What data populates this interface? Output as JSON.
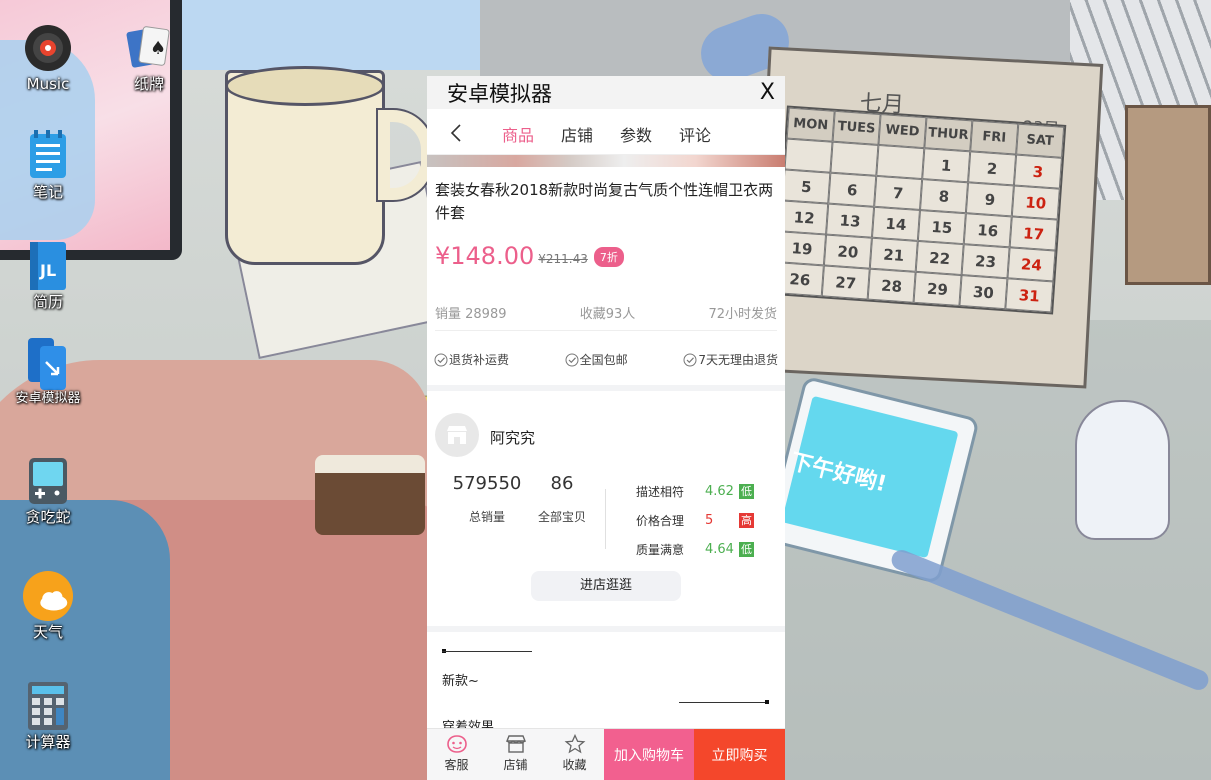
{
  "desktop": {
    "icons": [
      {
        "label": "Music",
        "icon": "music-disc-icon"
      },
      {
        "label": "纸牌",
        "icon": "solitaire-cards-icon"
      },
      {
        "label": "笔记",
        "icon": "notes-icon"
      },
      {
        "label": "简历",
        "icon": "resume-icon"
      },
      {
        "label": "安卓模拟器",
        "icon": "android-emulator-icon"
      },
      {
        "label": "贪吃蛇",
        "icon": "snake-game-icon"
      },
      {
        "label": "天气",
        "icon": "weather-icon"
      },
      {
        "label": "计算器",
        "icon": "calculator-icon"
      }
    ],
    "wallpaper": {
      "calendar_month": "七月",
      "calendar_date": "23日",
      "calendar_headers": [
        "MON",
        "TUES",
        "WED",
        "THUR",
        "FRI",
        "SAT"
      ],
      "calendar_rows": [
        [
          "",
          "",
          "",
          "1",
          "2",
          "3"
        ],
        [
          "5",
          "6",
          "7",
          "8",
          "9",
          "10"
        ],
        [
          "12",
          "13",
          "14",
          "15",
          "16",
          "17"
        ],
        [
          "19",
          "20",
          "21",
          "22",
          "23",
          "24"
        ],
        [
          "26",
          "27",
          "28",
          "29",
          "30",
          "31"
        ]
      ],
      "tablet_text": "下午好哟!"
    }
  },
  "window": {
    "title": "安卓模拟器",
    "close_label": "X"
  },
  "app": {
    "tabs": [
      {
        "label": "商品",
        "active": true
      },
      {
        "label": "店铺",
        "active": false
      },
      {
        "label": "参数",
        "active": false
      },
      {
        "label": "评论",
        "active": false
      }
    ],
    "product": {
      "title": "套装女春秋2018新款时尚复古气质个性连帽卫衣两件套",
      "price": "¥148.00",
      "original_price": "¥211.43",
      "discount": "7折",
      "sales": "销量 28989",
      "favorites": "收藏93人",
      "shipping": "72小时发货",
      "services": [
        "退货补运费",
        "全国包邮",
        "7天无理由退货"
      ]
    },
    "shop": {
      "name": "阿究究",
      "total_sales": "579550",
      "total_sales_label": "总销量",
      "all_items": "86",
      "all_items_label": "全部宝贝",
      "ratings": [
        {
          "label": "描述相符",
          "score": "4.62",
          "tag": "低",
          "color": "#4caf50"
        },
        {
          "label": "价格合理",
          "score": "5",
          "tag": "高",
          "color": "#e53935"
        },
        {
          "label": "质量满意",
          "score": "4.64",
          "tag": "低",
          "color": "#4caf50"
        }
      ],
      "enter_label": "进店逛逛"
    },
    "description": {
      "line1": "新款~",
      "line2": "穿着效果"
    },
    "bottom_bar": {
      "service": "客服",
      "store": "店铺",
      "favorite": "收藏",
      "add_to_cart": "加入购物车",
      "buy_now": "立即购买"
    },
    "colors": {
      "accent": "#ec5f8b",
      "cart": "#f2608f",
      "buy": "#f4472b"
    }
  }
}
